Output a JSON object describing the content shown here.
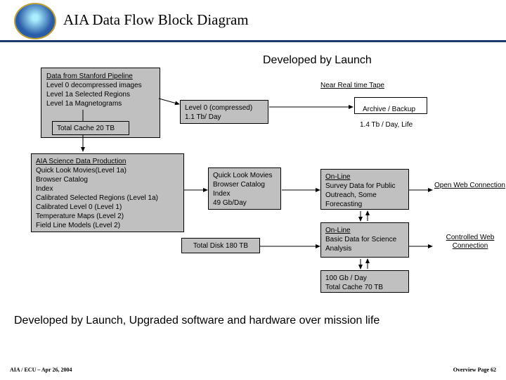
{
  "header": {
    "title": "AIA Data Flow Block Diagram"
  },
  "labels": {
    "developed": "Developed by Launch",
    "nrt_tape": "Near Real time Tape",
    "archive": "Archive / Backup",
    "tape_rate": "1.4 Tb / Day, Life",
    "open_web": "Open Web Connection",
    "ctrl_web": "Controlled Web Connection",
    "bottom": "Developed by Launch, Upgraded software and hardware over mission life"
  },
  "boxes": {
    "stanford": {
      "title": "Data from Stanford Pipeline",
      "lines": [
        "Level 0 decompressed images",
        "Level 1a Selected Regions",
        "Level 1a Magnetograms"
      ]
    },
    "cache": "Total Cache 20 TB",
    "level0": {
      "l1": "Level 0 (compressed)",
      "l2": "1.1 Tb/ Day"
    },
    "science": {
      "title": "AIA Science Data Production",
      "lines": [
        "Quick Look Movies(Level 1a)",
        "Browser Catalog",
        "Index",
        "Calibrated Selected Regions (Level 1a)",
        "Calibrated Level 0 (Level 1)",
        "Temperature Maps (Level 2)",
        "Field Line Models (Level 2)"
      ]
    },
    "qlm": {
      "lines": [
        "Quick Look Movies",
        "Browser Catalog",
        "Index",
        "49 Gb/Day"
      ]
    },
    "disk": "Total Disk 180 TB",
    "online_survey": {
      "title": "On-Line",
      "body": "Survey Data for Public Outreach, Some Forecasting"
    },
    "online_basic": {
      "title": "On-Line",
      "body": "Basic Data for Science Analysis"
    },
    "cache70": {
      "l1": "100 Gb / Day",
      "l2": "Total Cache 70 TB"
    }
  },
  "footer": {
    "left": "AIA / ECU – Apr 26, 2004",
    "right": "Overview Page 62"
  }
}
